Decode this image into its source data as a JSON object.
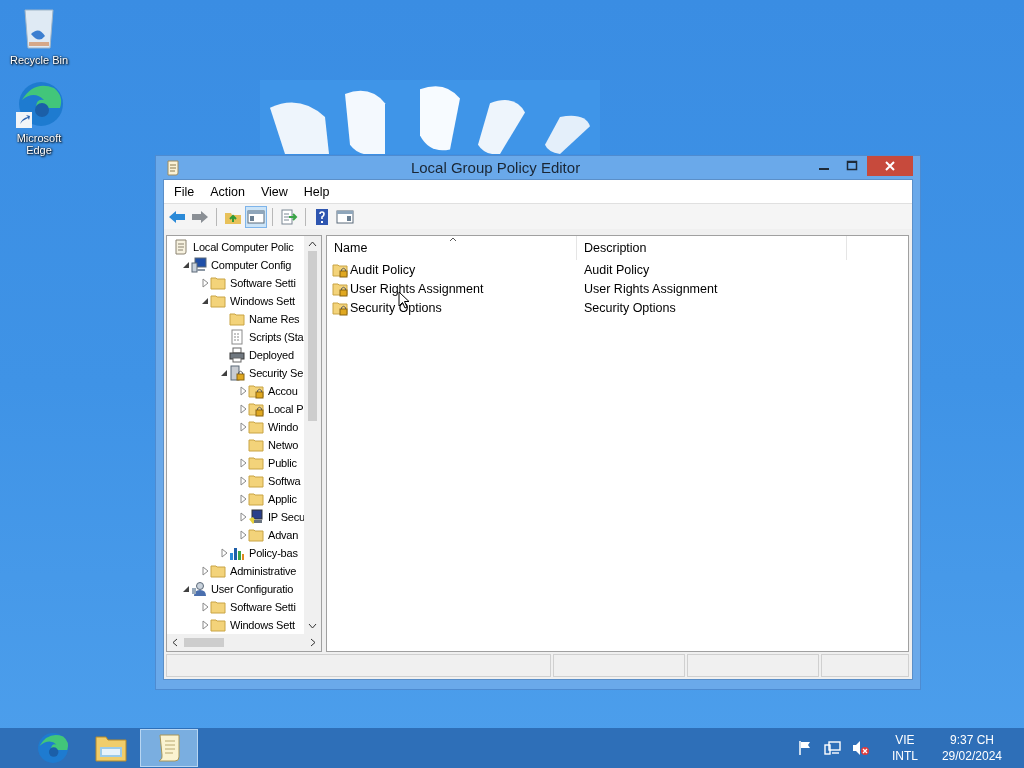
{
  "desktop_icons": [
    {
      "label": "Recycle Bin",
      "kind": "recycle-bin"
    },
    {
      "label": "Microsoft Edge",
      "kind": "edge"
    }
  ],
  "window": {
    "title": "Local Group Policy Editor",
    "menu": [
      "File",
      "Action",
      "View",
      "Help"
    ],
    "toolbar": [
      {
        "kind": "back",
        "pressed": false
      },
      {
        "kind": "forward",
        "pressed": false
      },
      {
        "kind": "up-folder",
        "pressed": false
      },
      {
        "kind": "tree-pane",
        "pressed": true
      },
      {
        "kind": "export",
        "pressed": false
      },
      {
        "kind": "help",
        "pressed": false
      },
      {
        "kind": "action-pane",
        "pressed": false
      }
    ],
    "tree": {
      "items": [
        {
          "label": "Local Computer Polic",
          "kind": "scroll",
          "children": [
            {
              "label": "Computer Config",
              "kind": "computer",
              "expanded": true,
              "children": [
                {
                  "label": "Software Setti",
                  "kind": "folder",
                  "expanded": false
                },
                {
                  "label": "Windows Sett",
                  "kind": "folder",
                  "expanded": true,
                  "children": [
                    {
                      "label": "Name Res",
                      "kind": "folder"
                    },
                    {
                      "label": "Scripts (Sta",
                      "kind": "script"
                    },
                    {
                      "label": "Deployed",
                      "kind": "printer"
                    },
                    {
                      "label": "Security Se",
                      "kind": "security",
                      "expanded": true,
                      "children": [
                        {
                          "label": "Accou",
                          "kind": "folder-lock",
                          "expanded": false
                        },
                        {
                          "label": "Local P",
                          "kind": "folder-lock",
                          "expanded": false
                        },
                        {
                          "label": "Windo",
                          "kind": "folder",
                          "expanded": false
                        },
                        {
                          "label": "Netwo",
                          "kind": "folder"
                        },
                        {
                          "label": "Public",
                          "kind": "folder",
                          "expanded": false
                        },
                        {
                          "label": "Softwa",
                          "kind": "folder",
                          "expanded": false
                        },
                        {
                          "label": "Applic",
                          "kind": "folder",
                          "expanded": false
                        },
                        {
                          "label": "IP Secu",
                          "kind": "ipsec",
                          "expanded": false
                        },
                        {
                          "label": "Advan",
                          "kind": "folder",
                          "expanded": false
                        }
                      ]
                    },
                    {
                      "label": "Policy-bas",
                      "kind": "chart",
                      "expanded": false
                    }
                  ]
                },
                {
                  "label": "Administrative",
                  "kind": "folder",
                  "expanded": false
                }
              ]
            },
            {
              "label": "User Configuratio",
              "kind": "user",
              "expanded": true,
              "children": [
                {
                  "label": "Software Setti",
                  "kind": "folder",
                  "expanded": false
                },
                {
                  "label": "Windows Sett",
                  "kind": "folder",
                  "expanded": false
                }
              ]
            }
          ]
        }
      ]
    },
    "list": {
      "columns": [
        "Name",
        "Description"
      ],
      "rows": [
        {
          "name": "Audit Policy",
          "description": "Audit Policy"
        },
        {
          "name": "User Rights Assignment",
          "description": "User Rights Assignment"
        },
        {
          "name": "Security Options",
          "description": "Security Options"
        }
      ]
    }
  },
  "taskbar": {
    "apps": [
      {
        "kind": "edge",
        "selected": false
      },
      {
        "kind": "explorer",
        "selected": false
      },
      {
        "kind": "scroll",
        "selected": true
      }
    ],
    "tray": {
      "language": "VIE",
      "layout": "INTL",
      "time": "9:37 CH",
      "date": "29/02/2024"
    }
  }
}
